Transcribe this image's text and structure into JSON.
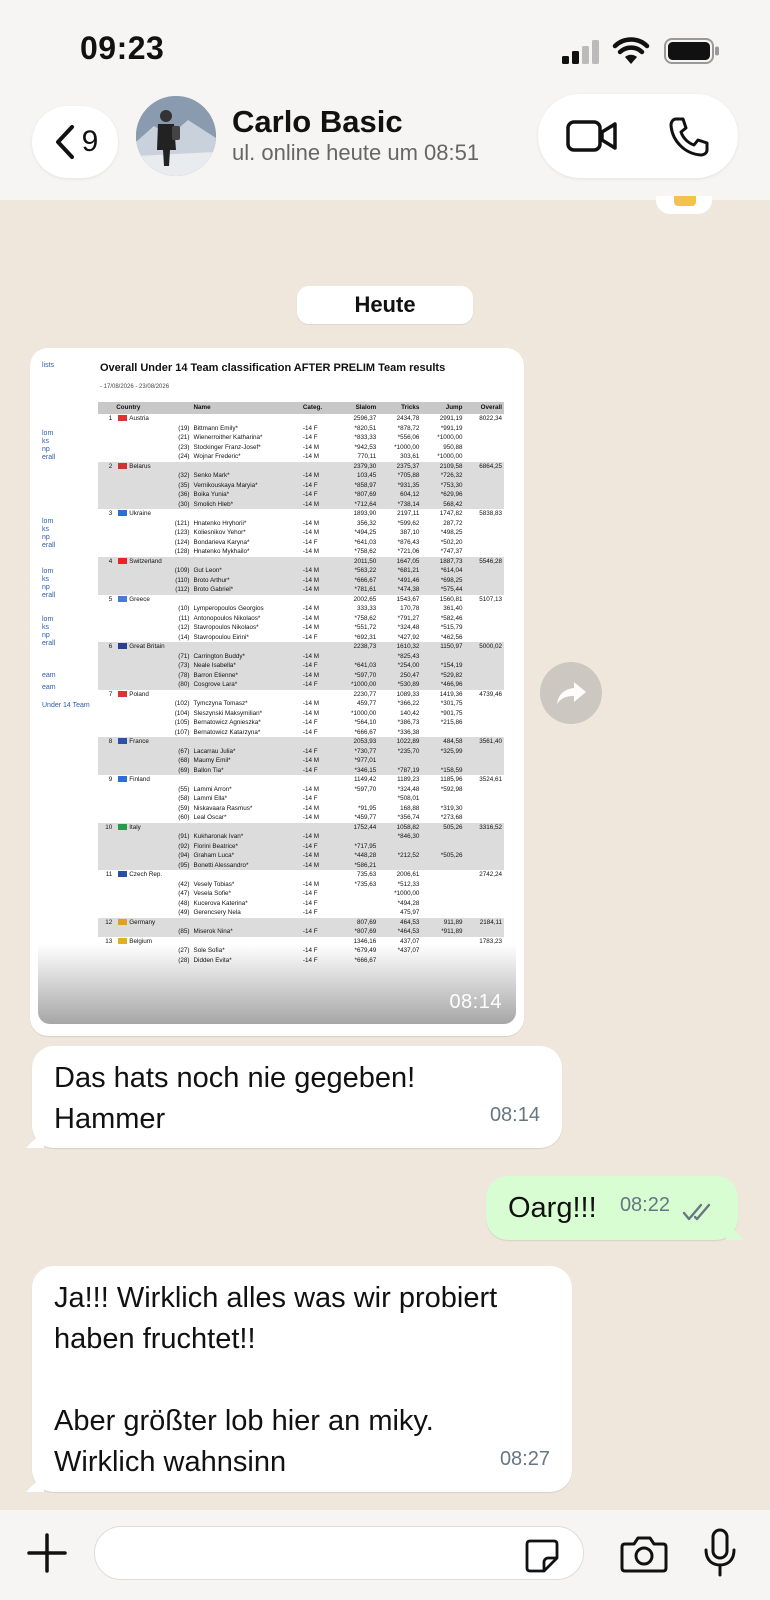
{
  "status_bar": {
    "time": "09:23"
  },
  "header": {
    "back_count": "9",
    "contact_name": "Carlo Basic",
    "contact_status": "ul. online heute um 08:51"
  },
  "day_chip": "Heute",
  "image_message": {
    "time": "08:14",
    "doc": {
      "title": "Overall Under 14 Team classification AFTER PRELIM Team results",
      "dates": "- 17/08/2026 - 23/08/2026",
      "side_links": [
        "lists",
        "lom",
        "ks",
        "np",
        "erall",
        "lom",
        "ks",
        "np",
        "erall",
        "lom",
        "ks",
        "np",
        "erall",
        "lom",
        "ks",
        "np",
        "erall",
        "eam",
        "eam",
        "Under 14 Team"
      ],
      "headers": [
        "",
        "Country",
        "Name",
        "Categ.",
        "Slalom",
        "Tricks",
        "Jump",
        "Overall"
      ],
      "teams": [
        {
          "rank": "1",
          "flag": "#d33",
          "country": "Austria",
          "slalom": "2596,37",
          "tricks": "2434,78",
          "jump": "2991,19",
          "overall": "8022,34",
          "members": [
            [
              "(19)",
              "Bittmann Emily*",
              "-14 F",
              "*820,51",
              "*878,72",
              "*991,19"
            ],
            [
              "(21)",
              "Wienerroither Katharina*",
              "-14 F",
              "*833,33",
              "*556,06",
              "*1000,00"
            ],
            [
              "(23)",
              "Stockinger Franz-Josef*",
              "-14 M",
              "*942,53",
              "*1000,00",
              "950,88"
            ],
            [
              "(24)",
              "Wojnar Frederic*",
              "-14 M",
              "770,11",
              "303,61",
              "*1000,00"
            ]
          ]
        },
        {
          "rank": "2",
          "flag": "#c33",
          "country": "Belarus",
          "slalom": "2379,30",
          "tricks": "2375,37",
          "jump": "2109,58",
          "overall": "6864,25",
          "members": [
            [
              "(32)",
              "Senko Mark*",
              "-14 M",
              "103,45",
              "*705,88",
              "*726,32"
            ],
            [
              "(35)",
              "Vernikouskaya Maryia*",
              "-14 F",
              "*858,97",
              "*931,35",
              "*753,30"
            ],
            [
              "(36)",
              "Boika Yunia*",
              "-14 F",
              "*807,69",
              "604,12",
              "*629,96"
            ],
            [
              "(30)",
              "Smolich Hleb*",
              "-14 M",
              "*712,64",
              "*738,14",
              "568,42"
            ]
          ]
        },
        {
          "rank": "3",
          "flag": "#2b6fd6",
          "country": "Ukraine",
          "slalom": "1893,90",
          "tricks": "2197,11",
          "jump": "1747,82",
          "overall": "5838,83",
          "members": [
            [
              "(121)",
              "Hnatenko Hryhorii*",
              "-14 M",
              "356,32",
              "*599,62",
              "287,72"
            ],
            [
              "(123)",
              "Koliesnikov Yehor*",
              "-14 M",
              "*494,25",
              "387,10",
              "*498,25"
            ],
            [
              "(124)",
              "Bondarieva Karyna*",
              "-14 F",
              "*641,03",
              "*876,43",
              "*502,20"
            ],
            [
              "(128)",
              "Hnatenko Mykhailo*",
              "-14 M",
              "*758,62",
              "*721,06",
              "*747,37"
            ]
          ]
        },
        {
          "rank": "4",
          "flag": "#e22",
          "country": "Switzerland",
          "slalom": "2011,50",
          "tricks": "1647,05",
          "jump": "1887,73",
          "overall": "5546,28",
          "members": [
            [
              "(109)",
              "Gut Leon*",
              "-14 M",
              "*563,22",
              "*681,21",
              "*614,04"
            ],
            [
              "(110)",
              "Broto Arthur*",
              "-14 M",
              "*666,67",
              "*491,46",
              "*698,25"
            ],
            [
              "(112)",
              "Broto Gabriel*",
              "-14 M",
              "*781,61",
              "*474,38",
              "*575,44"
            ]
          ]
        },
        {
          "rank": "5",
          "flag": "#4a7bd0",
          "country": "Greece",
          "slalom": "2002,65",
          "tricks": "1543,67",
          "jump": "1560,81",
          "overall": "5107,13",
          "members": [
            [
              "(10)",
              "Lymperopoulos Georgios",
              "-14 M",
              "333,33",
              "170,78",
              "361,40"
            ],
            [
              "(11)",
              "Antonopoulos Nikolaos*",
              "-14 M",
              "*758,62",
              "*791,27",
              "*582,46"
            ],
            [
              "(12)",
              "Stavropoulos Nikolaos*",
              "-14 M",
              "*551,72",
              "*324,48",
              "*515,79"
            ],
            [
              "(14)",
              "Stavropoulou Eirini*",
              "-14 F",
              "*692,31",
              "*427,92",
              "*462,56"
            ]
          ]
        },
        {
          "rank": "6",
          "flag": "#2a3f8f",
          "country": "Great Britain",
          "slalom": "2238,73",
          "tricks": "1610,32",
          "jump": "1150,97",
          "overall": "5000,02",
          "members": [
            [
              "(71)",
              "Carrington Buddy*",
              "-14 M",
              "",
              "*825,43",
              ""
            ],
            [
              "(73)",
              "Neale Isabella*",
              "-14 F",
              "*641,03",
              "*254,00",
              "*154,19"
            ],
            [
              "(78)",
              "Barron Etienne*",
              "-14 M",
              "*597,70",
              "250,47",
              "*529,82"
            ],
            [
              "(80)",
              "Cosgrove Lara*",
              "-14 F",
              "*1000,00",
              "*530,89",
              "*466,96"
            ]
          ]
        },
        {
          "rank": "7",
          "flag": "#d33",
          "country": "Poland",
          "slalom": "2230,77",
          "tricks": "1089,33",
          "jump": "1419,36",
          "overall": "4739,46",
          "members": [
            [
              "(102)",
              "Tymczyna Tomasz*",
              "-14 M",
              "459,77",
              "*366,22",
              "*301,75"
            ],
            [
              "(104)",
              "Sleszynski Maksymilian*",
              "-14 M",
              "*1000,00",
              "140,42",
              "*901,75"
            ],
            [
              "(105)",
              "Bernatowicz Agnieszka*",
              "-14 F",
              "*564,10",
              "*386,73",
              "*215,86"
            ],
            [
              "(107)",
              "Bernatowicz Katarzyna*",
              "-14 F",
              "*666,67",
              "*336,38",
              ""
            ]
          ]
        },
        {
          "rank": "8",
          "flag": "#2c4fb0",
          "country": "France",
          "slalom": "2053,93",
          "tricks": "1022,89",
          "jump": "484,58",
          "overall": "3561,40",
          "members": [
            [
              "(67)",
              "Lacarrau Julia*",
              "-14 F",
              "*730,77",
              "*235,70",
              "*325,99"
            ],
            [
              "(68)",
              "Maumy Emil*",
              "-14 M",
              "*977,01",
              "",
              ""
            ],
            [
              "(69)",
              "Ballon Tia*",
              "-14 F",
              "*346,15",
              "*787,19",
              "*158,59"
            ]
          ]
        },
        {
          "rank": "9",
          "flag": "#2f6fd0",
          "country": "Finland",
          "slalom": "1149,42",
          "tricks": "1189,23",
          "jump": "1185,96",
          "overall": "3524,61",
          "members": [
            [
              "(55)",
              "Lammi Arron*",
              "-14 M",
              "*597,70",
              "*324,48",
              "*592,98"
            ],
            [
              "(58)",
              "Lammi Ella*",
              "-14 F",
              "",
              "*508,01",
              ""
            ],
            [
              "(59)",
              "Niskavaara Rasmus*",
              "-14 M",
              "*91,95",
              "168,88",
              "*319,30"
            ],
            [
              "(60)",
              "Leal Oscar*",
              "-14 M",
              "*459,77",
              "*356,74",
              "*273,68"
            ]
          ]
        },
        {
          "rank": "10",
          "flag": "#2a9a4a",
          "country": "Italy",
          "slalom": "1752,44",
          "tricks": "1058,82",
          "jump": "505,26",
          "overall": "3316,52",
          "members": [
            [
              "(91)",
              "Kukharonak Ivan*",
              "-14 M",
              "",
              "*846,30",
              ""
            ],
            [
              "(92)",
              "Florini Beatrice*",
              "-14 F",
              "*717,95",
              "",
              ""
            ],
            [
              "(94)",
              "Graham Luca*",
              "-14 M",
              "*448,28",
              "*212,52",
              "*505,26"
            ],
            [
              "(95)",
              "Bonetti Alessandro*",
              "-14 M",
              "*586,21",
              "",
              ""
            ]
          ]
        },
        {
          "rank": "11",
          "flag": "#2a4fa0",
          "country": "Czech Rep.",
          "slalom": "735,63",
          "tricks": "2006,61",
          "jump": "",
          "overall": "2742,24",
          "members": [
            [
              "(42)",
              "Vesely Tobias*",
              "-14 M",
              "*735,63",
              "*512,33",
              ""
            ],
            [
              "(47)",
              "Vesela Sofie*",
              "-14 F",
              "",
              "*1000,00",
              ""
            ],
            [
              "(48)",
              "Kucerova Katerina*",
              "-14 F",
              "",
              "*494,28",
              ""
            ],
            [
              "(49)",
              "Gerencsery Nela",
              "-14 F",
              "",
              "475,97",
              ""
            ]
          ]
        },
        {
          "rank": "12",
          "flag": "#e0a020",
          "country": "Germany",
          "slalom": "807,69",
          "tricks": "464,53",
          "jump": "911,89",
          "overall": "2184,11",
          "members": [
            [
              "(85)",
              "Miserok Nina*",
              "-14 F",
              "*807,69",
              "*464,53",
              "*911,89"
            ]
          ]
        },
        {
          "rank": "13",
          "flag": "#e0b020",
          "country": "Belgium",
          "slalom": "1346,16",
          "tricks": "437,07",
          "jump": "",
          "overall": "1783,23",
          "members": [
            [
              "(27)",
              "Sole Sofia*",
              "-14 F",
              "*679,49",
              "*437,07",
              ""
            ],
            [
              "(28)",
              "Didden Evita*",
              "-14 F",
              "*666,67",
              "",
              ""
            ]
          ]
        }
      ]
    }
  },
  "messages": [
    {
      "text": "Das hats noch nie gegeben!\nHammer",
      "time": "08:14"
    },
    {
      "text": "Oarg!!!",
      "time": "08:22"
    },
    {
      "text": "Ja!!! Wirklich alles was wir probiert\nhaben fruchtet!!\n\nAber größter lob hier an miky.\nWirklich wahnsinn",
      "time": "08:27"
    }
  ],
  "input": {
    "placeholder": ""
  },
  "colors": {
    "incoming": "#ffffff",
    "outgoing": "#d9fdd3",
    "wallpaper": "#efe7dc",
    "read_ticks": "#667781"
  }
}
